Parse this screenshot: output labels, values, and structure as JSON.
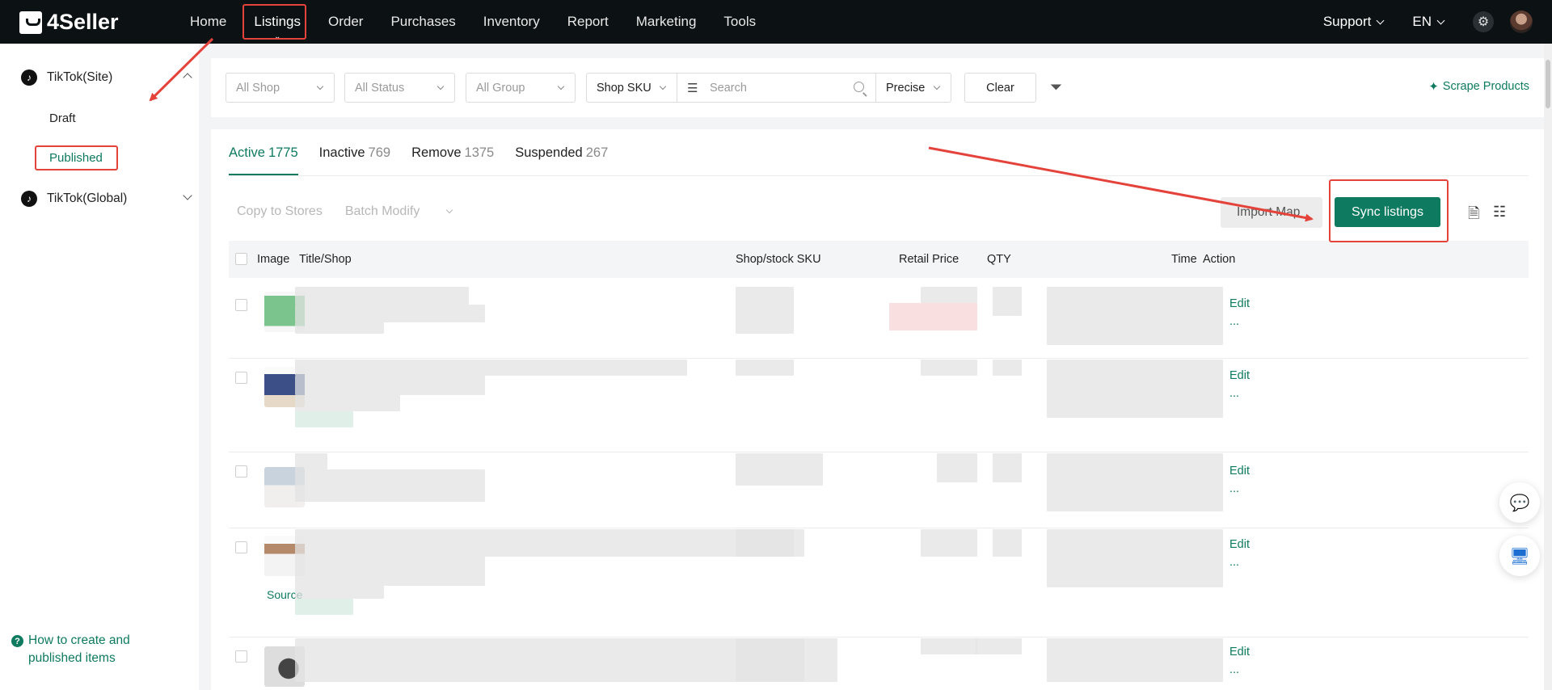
{
  "app": {
    "brand": "4Seller"
  },
  "topnav": {
    "items": [
      "Home",
      "Listings",
      "Order",
      "Purchases",
      "Inventory",
      "Report",
      "Marketing",
      "Tools"
    ],
    "active_index": 1,
    "support_label": "Support",
    "language_label": "EN"
  },
  "sidebar": {
    "groups": [
      {
        "label": "TikTok(Site)",
        "expanded": true,
        "items": [
          "Draft",
          "Published"
        ],
        "active_item": "Published"
      },
      {
        "label": "TikTok(Global)",
        "expanded": false
      }
    ],
    "help_line1": "How to create and",
    "help_line2": "published items"
  },
  "filters": {
    "shop": "All Shop",
    "status": "All Status",
    "group": "All Group",
    "sku_type": "Shop SKU",
    "search_placeholder": "Search",
    "match_mode": "Precise",
    "clear_label": "Clear",
    "scrape_label": "Scrape Products"
  },
  "tabs": [
    {
      "label": "Active",
      "count": "1775",
      "active": true
    },
    {
      "label": "Inactive",
      "count": "769",
      "active": false
    },
    {
      "label": "Remove",
      "count": "1375",
      "active": false
    },
    {
      "label": "Suspended",
      "count": "267",
      "active": false
    }
  ],
  "toolbar": {
    "copy_label": "Copy to Stores",
    "batch_label": "Batch Modify",
    "import_label": "Import Map",
    "sync_label": "Sync listings"
  },
  "table": {
    "columns": [
      "Image",
      "Title/Shop",
      "Shop/stock SKU",
      "Retail Price",
      "QTY",
      "Time",
      "Action"
    ],
    "rows": [
      {
        "edit": "Edit",
        "more": "...",
        "source": ""
      },
      {
        "edit": "Edit",
        "more": "...",
        "source": ""
      },
      {
        "edit": "Edit",
        "more": "...",
        "source": ""
      },
      {
        "edit": "Edit",
        "more": "...",
        "source": "Source"
      },
      {
        "edit": "Edit",
        "more": "...",
        "source": ""
      }
    ]
  },
  "colors": {
    "brand_green": "#0e7a5f",
    "topnav_bg": "#0c1114",
    "annotation_red": "#e4433b"
  }
}
